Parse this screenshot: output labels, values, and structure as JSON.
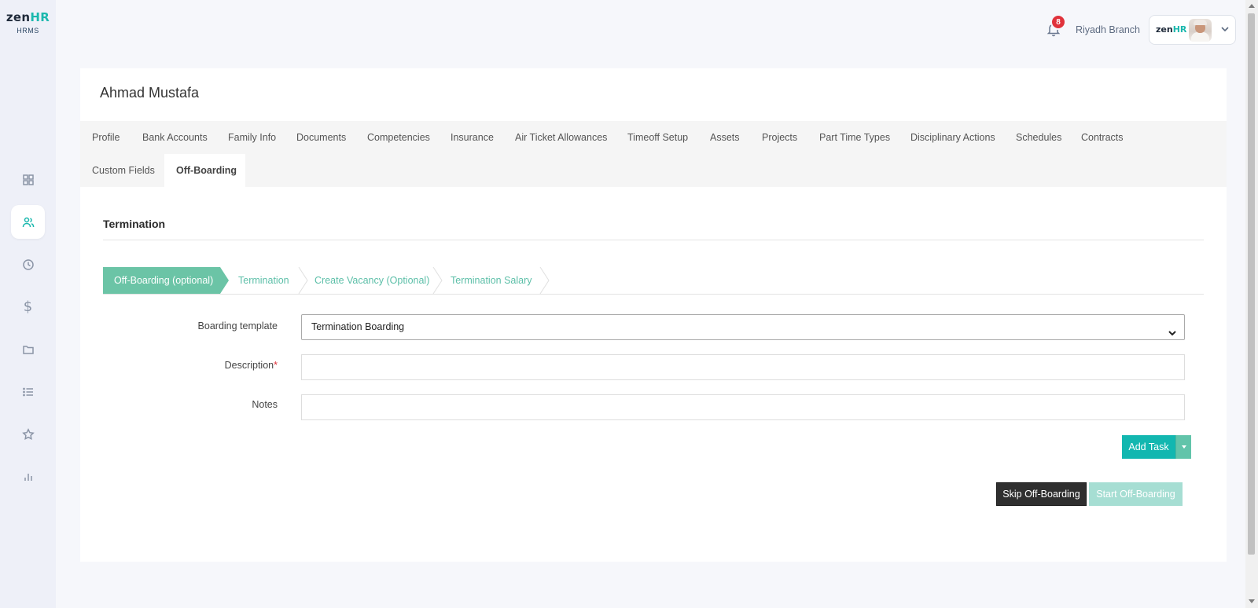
{
  "brand": {
    "logo_main": "zen",
    "logo_accent": "HR",
    "logo_sub": "HRMS",
    "accent_color": "#1bb8ae"
  },
  "sidebar": {
    "items": [
      {
        "icon": "dashboard-grid-icon"
      },
      {
        "icon": "users-icon",
        "active": true
      },
      {
        "icon": "clock-icon"
      },
      {
        "icon": "dollar-icon",
        "glyph": "$"
      },
      {
        "icon": "folder-icon"
      },
      {
        "icon": "list-icon"
      },
      {
        "icon": "star-icon"
      },
      {
        "icon": "bar-chart-icon"
      }
    ]
  },
  "topbar": {
    "notifications_count": "8",
    "branch": "Riyadh Branch",
    "profile_logo_main": "zen",
    "profile_logo_accent": "HR"
  },
  "employee": {
    "name": "Ahmad Mustafa"
  },
  "tabs": [
    {
      "label": "Profile"
    },
    {
      "label": "Bank Accounts"
    },
    {
      "label": "Family Info"
    },
    {
      "label": "Documents"
    },
    {
      "label": "Competencies"
    },
    {
      "label": "Insurance"
    },
    {
      "label": "Air Ticket Allowances"
    },
    {
      "label": "Timeoff Setup"
    },
    {
      "label": "Assets"
    },
    {
      "label": "Projects"
    },
    {
      "label": "Part Time Types"
    },
    {
      "label": "Disciplinary Actions"
    },
    {
      "label": "Schedules"
    },
    {
      "label": "Contracts"
    },
    {
      "label": "Custom Fields"
    },
    {
      "label": "Off-Boarding",
      "active": true
    }
  ],
  "section": {
    "title": "Termination"
  },
  "steps": [
    {
      "label": "Off-Boarding (optional)",
      "active": true
    },
    {
      "label": "Termination"
    },
    {
      "label": "Create Vacancy (Optional)"
    },
    {
      "label": "Termination Salary"
    }
  ],
  "form": {
    "boarding_template_label": "Boarding template",
    "boarding_template_value": "Termination Boarding",
    "description_label": "Description",
    "description_required": "*",
    "description_value": "",
    "notes_label": "Notes",
    "notes_value": ""
  },
  "actions": {
    "add_task": "Add Task",
    "skip": "Skip Off-Boarding",
    "start": "Start Off-Boarding"
  }
}
